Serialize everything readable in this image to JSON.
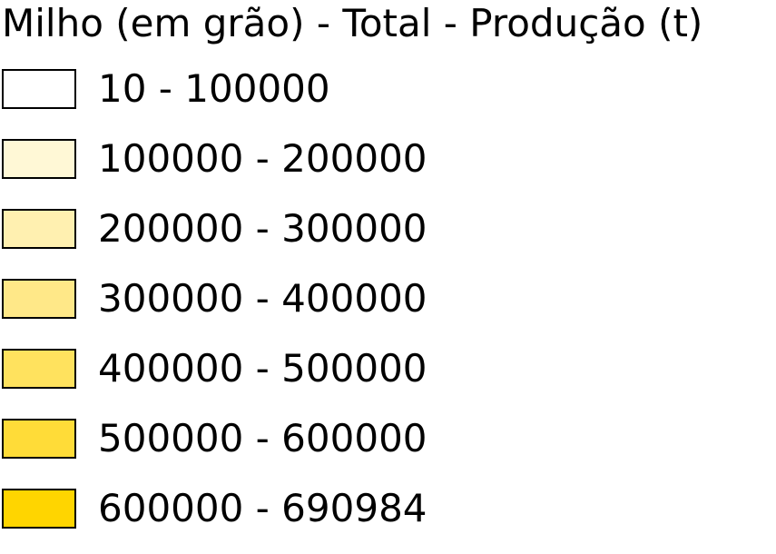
{
  "legend": {
    "title": "Milho (em grão) - Total -  Produção (t)",
    "items": [
      {
        "label": "10 - 100000",
        "color": "#ffffff"
      },
      {
        "label": "100000 - 200000",
        "color": "#fff8d6"
      },
      {
        "label": "200000 - 300000",
        "color": "#fff0b0"
      },
      {
        "label": "300000 - 400000",
        "color": "#ffe888"
      },
      {
        "label": "400000 - 500000",
        "color": "#ffe25e"
      },
      {
        "label": "500000 - 600000",
        "color": "#ffdc38"
      },
      {
        "label": "600000 - 690984",
        "color": "#ffd500"
      }
    ]
  }
}
